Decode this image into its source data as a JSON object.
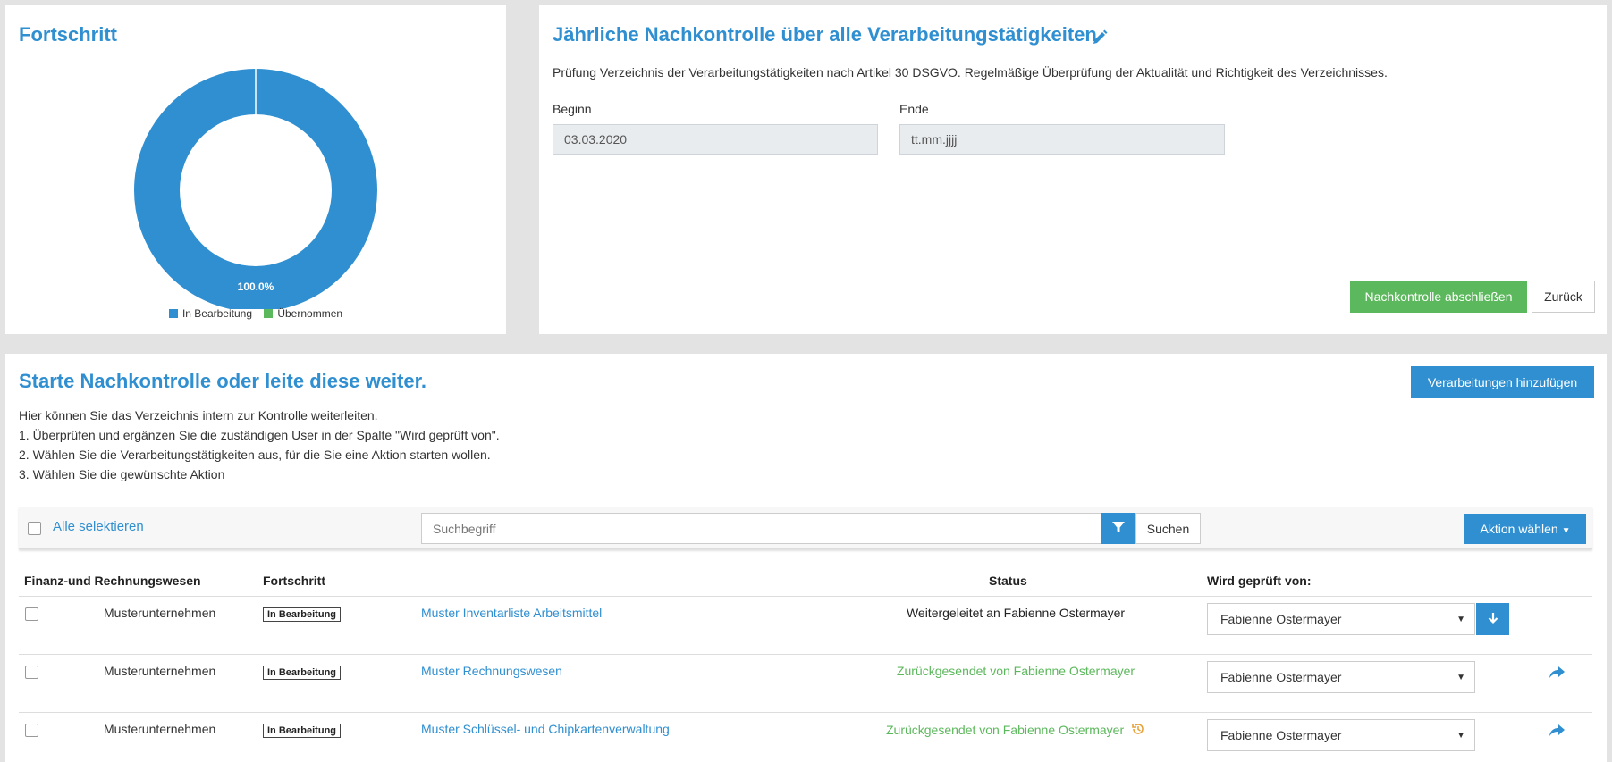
{
  "progress": {
    "title": "Fortschritt",
    "chart_data": {
      "type": "pie",
      "donut": true,
      "categories": [
        "In Bearbeitung",
        "Übernommen"
      ],
      "values": [
        100.0,
        0.0
      ],
      "colors": [
        "#2f8fd0",
        "#5cb85c"
      ],
      "data_label": "100.0%",
      "legend_position": "bottom"
    }
  },
  "review": {
    "title": "Jährliche Nachkontrolle über alle Verarbeitungstätigkeiten",
    "description": "Prüfung Verzeichnis der Verarbeitungstätigkeiten nach Artikel 30 DSGVO. Regelmäßige Überprüfung der Aktualität und Richtigkeit des Verzeichnisses.",
    "begin_label": "Beginn",
    "begin_value": "03.03.2020",
    "end_label": "Ende",
    "end_placeholder": "tt.mm.jjjj",
    "complete_button": "Nachkontrolle abschließen",
    "back_button": "Zurück"
  },
  "main": {
    "title": "Starte Nachkontrolle oder leite diese weiter.",
    "add_button": "Verarbeitungen hinzufügen",
    "instructions": [
      "Hier können Sie das Verzeichnis intern zur Kontrolle weiterleiten.",
      "1. Überprüfen und ergänzen Sie die zuständigen User in der Spalte \"Wird geprüft von\".",
      "2. Wählen Sie die Verarbeitungstätigkeiten aus, für die Sie eine Aktion starten wollen.",
      "3. Wählen Sie die gewünschte Aktion"
    ],
    "select_all": "Alle selektieren",
    "search_placeholder": "Suchbegriff",
    "search_button": "Suchen",
    "action_button": "Aktion wählen",
    "columns": {
      "department": "Finanz-und Rechnungswesen",
      "progress": "Fortschritt",
      "status": "Status",
      "reviewer": "Wird geprüft von:"
    },
    "rows": [
      {
        "company": "Musterunternehmen",
        "badge": "In Bearbeitung",
        "name": "Muster Inventarliste Arbeitsmittel",
        "status": "Weitergeleitet an Fabienne Ostermayer",
        "reviewer": "Fabienne Ostermayer"
      },
      {
        "company": "Musterunternehmen",
        "badge": "In Bearbeitung",
        "name": "Muster Rechnungswesen",
        "status": "Zurückgesendet von Fabienne Ostermayer",
        "reviewer": "Fabienne Ostermayer"
      },
      {
        "company": "Musterunternehmen",
        "badge": "In Bearbeitung",
        "name": "Muster Schlüssel- und Chipkartenverwaltung",
        "status": "Zurückgesendet von Fabienne Ostermayer",
        "reviewer": "Fabienne Ostermayer"
      }
    ]
  },
  "colors": {
    "accent": "#2f8fd0",
    "success": "#5cb85c"
  }
}
